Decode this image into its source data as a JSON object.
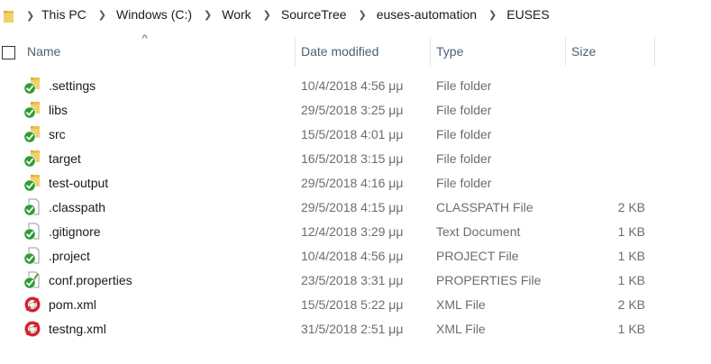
{
  "breadcrumb": [
    "This PC",
    "Windows (C:)",
    "Work",
    "SourceTree",
    "euses-automation",
    "EUSES"
  ],
  "header": {
    "name": "Name",
    "date_modified": "Date modified",
    "type": "Type",
    "size": "Size"
  },
  "files": [
    {
      "name": ".settings",
      "date": "10/4/2018 4:56 μμ",
      "type": "File folder",
      "size": "",
      "icon": "folder-synced-icon"
    },
    {
      "name": "libs",
      "date": "29/5/2018 3:25 μμ",
      "type": "File folder",
      "size": "",
      "icon": "folder-synced-icon"
    },
    {
      "name": "src",
      "date": "15/5/2018 4:01 μμ",
      "type": "File folder",
      "size": "",
      "icon": "folder-synced-icon"
    },
    {
      "name": "target",
      "date": "16/5/2018 3:15 μμ",
      "type": "File folder",
      "size": "",
      "icon": "folder-synced-icon"
    },
    {
      "name": "test-output",
      "date": "29/5/2018 4:16 μμ",
      "type": "File folder",
      "size": "",
      "icon": "folder-synced-icon"
    },
    {
      "name": ".classpath",
      "date": "29/5/2018 4:15 μμ",
      "type": "CLASSPATH File",
      "size": "2 KB",
      "icon": "file-synced-icon"
    },
    {
      "name": ".gitignore",
      "date": "12/4/2018 3:29 μμ",
      "type": "Text Document",
      "size": "1 KB",
      "icon": "file-synced-icon"
    },
    {
      "name": ".project",
      "date": "10/4/2018 4:56 μμ",
      "type": "PROJECT File",
      "size": "1 KB",
      "icon": "file-synced-icon"
    },
    {
      "name": "conf.properties",
      "date": "23/5/2018 3:31 μμ",
      "type": "PROPERTIES File",
      "size": "1 KB",
      "icon": "properties-synced-icon"
    },
    {
      "name": "pom.xml",
      "date": "15/5/2018 5:22 μμ",
      "type": "XML File",
      "size": "2 KB",
      "icon": "file-modified-icon"
    },
    {
      "name": "testng.xml",
      "date": "31/5/2018 2:51 μμ",
      "type": "XML File",
      "size": "1 KB",
      "icon": "file-modified-icon"
    }
  ],
  "colors": {
    "header_text": "#4c607a",
    "folder_yellow": "#e8c04a",
    "synced_green": "#2e9d36",
    "modified_red": "#d4242c"
  }
}
